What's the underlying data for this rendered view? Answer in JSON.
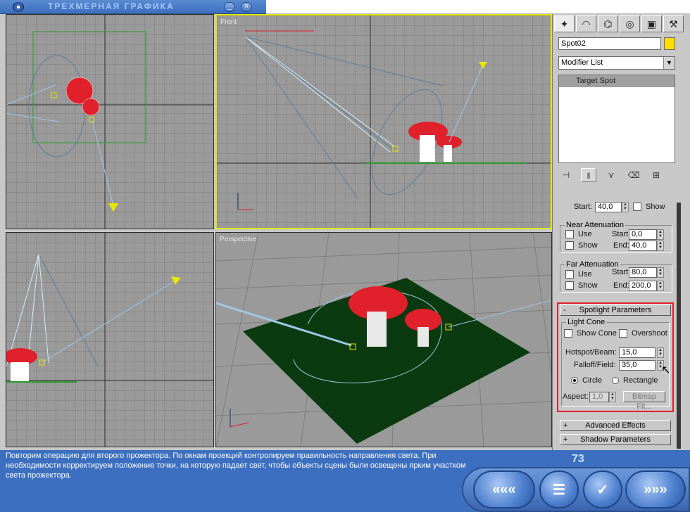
{
  "window": {
    "title": "ТРЕХМЕРНАЯ ГРАФИКА",
    "minimize": "_",
    "close": "×"
  },
  "viewports": {
    "front_label": "Front",
    "perspective_label": "Perspective"
  },
  "panel": {
    "tabs": [
      "create-icon",
      "modify-icon",
      "hierarchy-icon",
      "motion-icon",
      "display-icon",
      "utilities-icon"
    ],
    "object_name": "Spot02",
    "object_color": "#ffdc00",
    "modifier_list": "Modifier List",
    "stack_item": "Target Spot",
    "decay": {
      "start_label": "Start:",
      "start_value": "40,0",
      "show_label": "Show"
    },
    "near": {
      "title": "Near Attenuation",
      "use": "Use",
      "show": "Show",
      "start_label": "Start:",
      "start_value": "0,0",
      "end_label": "End:",
      "end_value": "40,0"
    },
    "far": {
      "title": "Far Attenuation",
      "use": "Use",
      "show": "Show",
      "start_label": "Start:",
      "start_value": "80,0",
      "end_label": "End:",
      "end_value": "200,0"
    },
    "spotlight": {
      "rollout_sign": "-",
      "title": "Spotlight Parameters",
      "light_cone": "Light Cone",
      "show_cone": "Show Cone",
      "overshoot": "Overshoot",
      "hotspot_label": "Hotspot/Beam:",
      "hotspot_value": "15,0",
      "falloff_label": "Falloff/Field:",
      "falloff_value": "35,0",
      "circle": "Circle",
      "rectangle": "Rectangle",
      "aspect_label": "Aspect:",
      "aspect_value": "1,0",
      "bitmap_fit": "Bitmap Fit..."
    },
    "advanced": {
      "sign": "+",
      "title": "Advanced Effects"
    },
    "shadow": {
      "sign": "+",
      "title": "Shadow Parameters"
    }
  },
  "lesson": {
    "text": "Повторим операцию для второго прожектора. По окнам проекций контролируем правильность направления света. При необходимости корректируем положение точки, на которую падает свет, чтобы объекты сцены были освещены ярким участком света прожектора.",
    "page": "73"
  },
  "nav": {
    "back": "«««",
    "menu": "☰",
    "check": "✓",
    "forward": "»»»"
  },
  "colors": {
    "accent": "#3c6fc0",
    "mushroom": "#e0202a",
    "ground": "#0b3a10",
    "highlight": "#e6e600"
  }
}
